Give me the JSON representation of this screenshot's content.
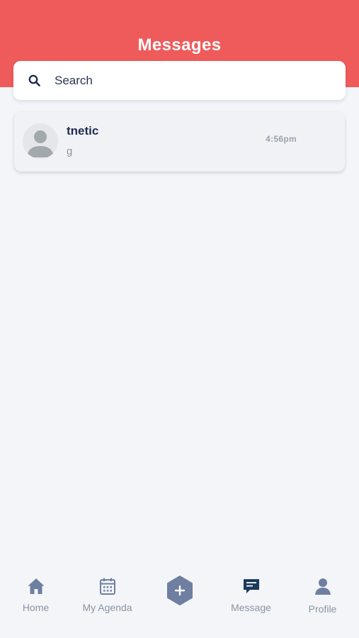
{
  "header": {
    "title": "Messages",
    "color": "#ef5b5b"
  },
  "search": {
    "placeholder": "Search",
    "icon": "search-icon"
  },
  "conversations": [
    {
      "name": "tnetic",
      "preview": "g",
      "time": "4:56pm",
      "avatar_icon": "default-user-avatar-icon"
    }
  ],
  "tabbar": {
    "tabs": [
      {
        "label": "Home",
        "icon": "home-icon",
        "active": false
      },
      {
        "label": "My Agenda",
        "icon": "calendar-icon",
        "active": false
      },
      {
        "label": "",
        "icon": "plus-icon",
        "active": false
      },
      {
        "label": "Message",
        "icon": "message-icon",
        "active": true
      },
      {
        "label": "Profile",
        "icon": "profile-icon",
        "active": false
      }
    ],
    "active_color": "#1b3a5c",
    "inactive_color": "#8a93a3"
  }
}
